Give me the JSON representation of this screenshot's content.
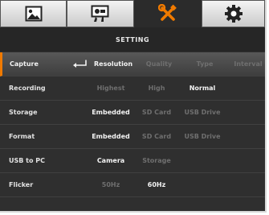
{
  "tabs": [
    {
      "name": "photo-tab",
      "icon": "picture-icon"
    },
    {
      "name": "video-tab",
      "icon": "camera-recording-icon"
    },
    {
      "name": "setting-tab",
      "icon": "tools-icon",
      "active": true
    },
    {
      "name": "system-tab",
      "icon": "gear-icon"
    }
  ],
  "colors": {
    "accent": "#f07a00",
    "active_text": "#f3f3f3",
    "inactive_text": "#6f6f6f"
  },
  "header": {
    "title": "SETTING"
  },
  "rows": [
    {
      "label": "Capture",
      "options": [
        "Resolution",
        "Quality",
        "Type",
        "Interval"
      ]
    },
    {
      "label": "Recording",
      "options": [
        "Highest",
        "High",
        "Normal"
      ]
    },
    {
      "label": "Storage",
      "options": [
        "Embedded",
        "SD Card",
        "USB Drive"
      ]
    },
    {
      "label": "Format",
      "options": [
        "Embedded",
        "SD Card",
        "USB Drive"
      ]
    },
    {
      "label": "USB to PC",
      "options": [
        "Camera",
        "Storage"
      ]
    },
    {
      "label": "Flicker",
      "options": [
        "50Hz",
        "60Hz"
      ]
    }
  ]
}
